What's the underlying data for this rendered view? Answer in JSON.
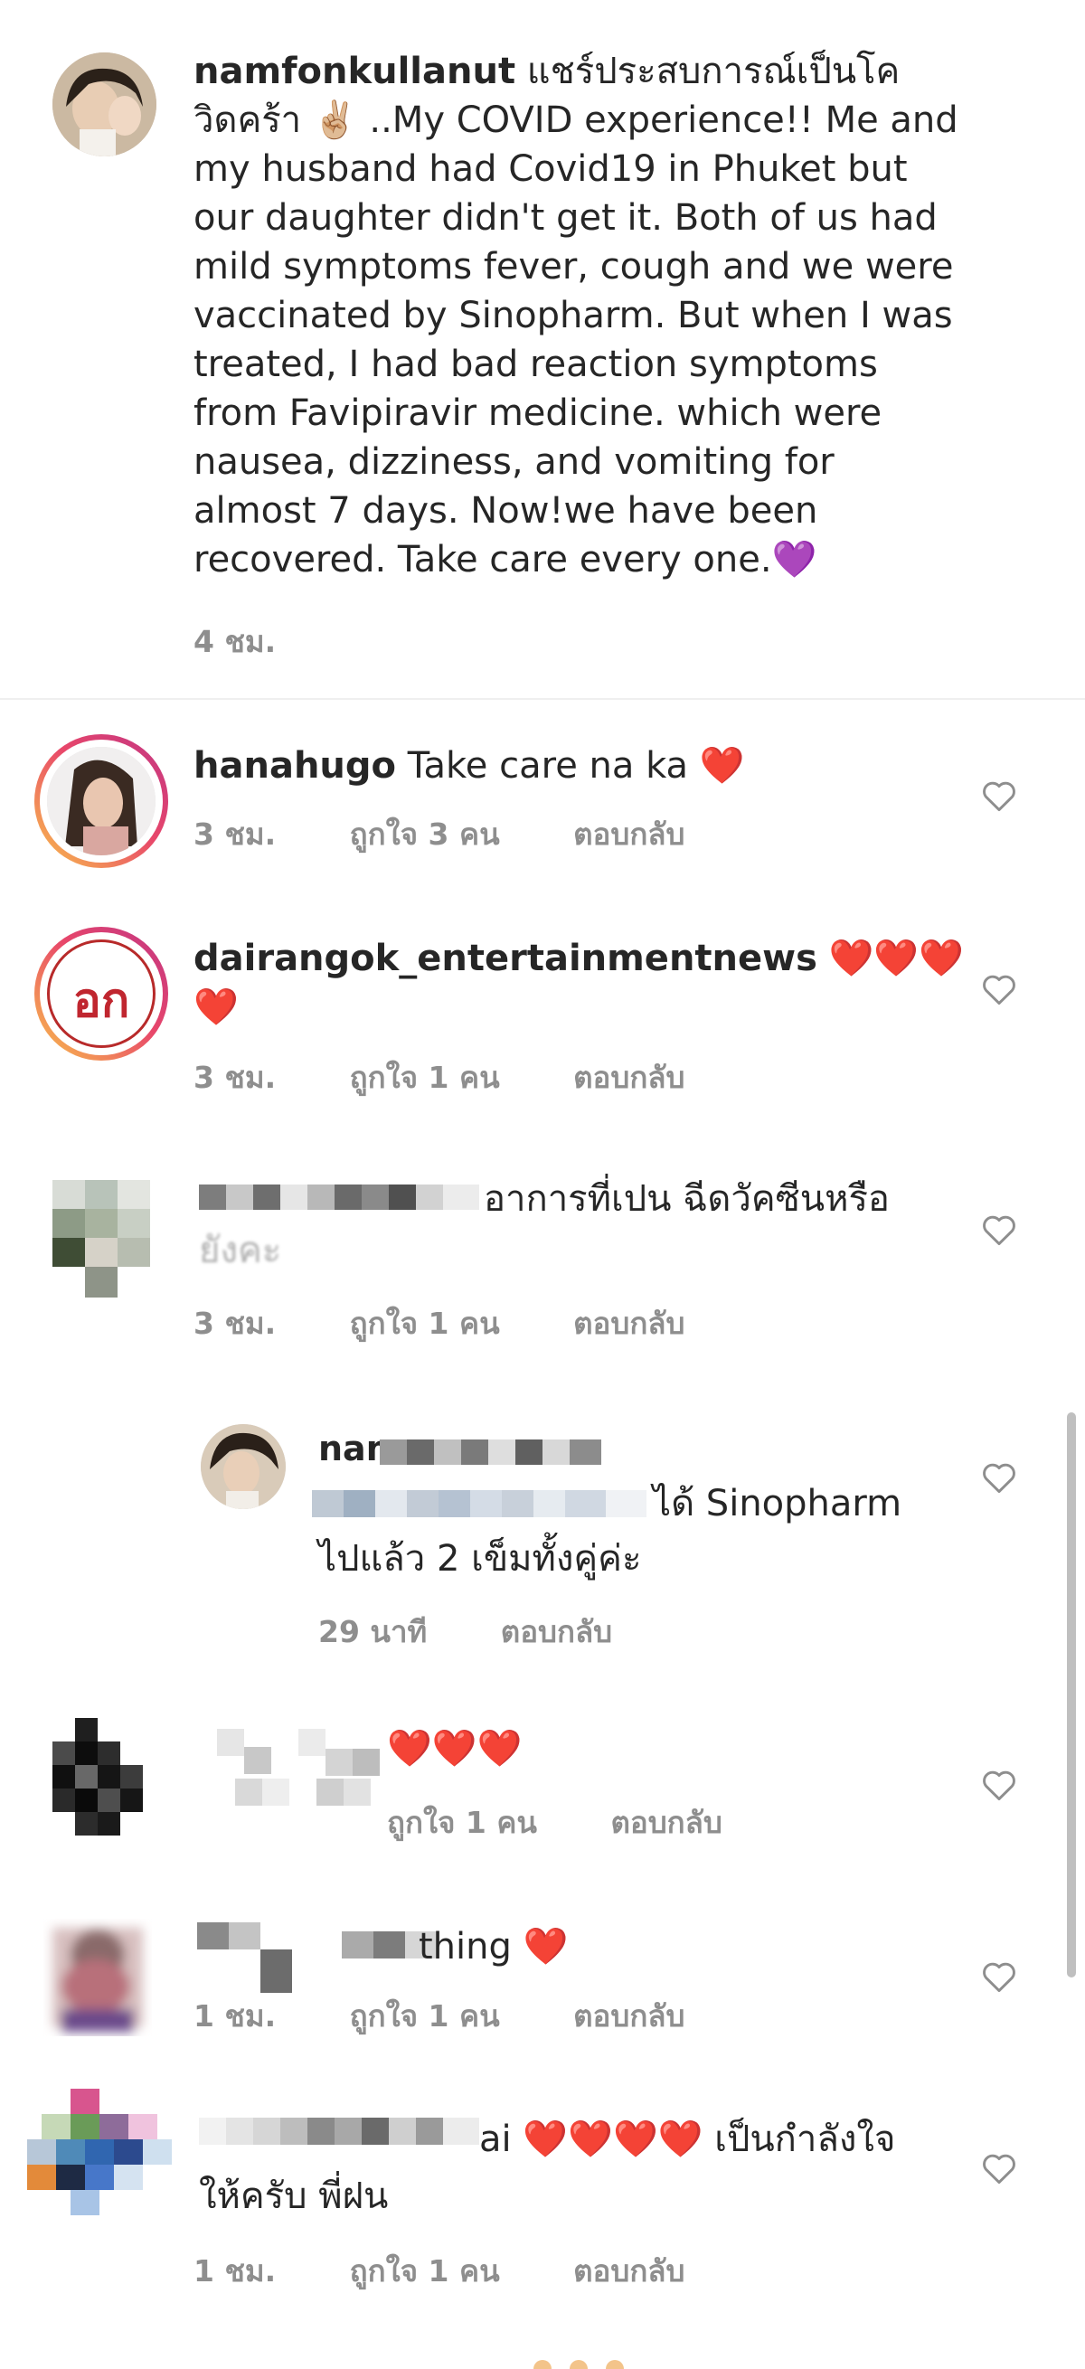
{
  "caption": {
    "username": "namfonkullanut",
    "lines": [
      "แชร์ประสบการณ์เป็นโค",
      "วิดคร้า ✌🏼 ..My COVID experience!! Me and",
      "my husband had Covid19 in Phuket but",
      "our daughter didn't get it. Both of us had",
      "mild symptoms fever, cough and we were",
      "vaccinated by Sinopharm. But when I was",
      "treated, I had bad reaction symptoms",
      "from Favipiravir medicine. which were",
      "nausea, dizziness, and vomiting for",
      "almost 7 days. Now!we have been",
      "recovered. Take care every one.💜"
    ],
    "time": "4 ชม."
  },
  "comments": [
    {
      "username": "hanahugo",
      "text": "Take care na ka ❤️",
      "time": "3 ชม.",
      "likes": "ถูกใจ 3 คน",
      "reply": "ตอบกลับ"
    },
    {
      "username": "dairangok_entertainmentnews",
      "text": "❤️❤️❤️",
      "text2": "❤️",
      "time": "3 ชม.",
      "likes": "ถูกใจ 1 คน",
      "reply": "ตอบกลับ",
      "avatar_text": "อก"
    },
    {
      "text": "อาการที่เปน ฉีดวัคซีนหรือ",
      "text2": "ยังคะ",
      "time": "3 ชม.",
      "likes": "ถูกใจ 1 คน",
      "reply": "ตอบกลับ"
    },
    {
      "username_partial": "nam",
      "text": "ได้ Sinopharm",
      "text2": "ไปแล้ว 2 เข็มทั้งคู่ค่ะ",
      "time": "29 นาที",
      "reply": "ตอบกลับ"
    },
    {
      "text": "❤️❤️❤️",
      "likes": "ถูกใจ 1 คน",
      "reply": "ตอบกลับ"
    },
    {
      "text": "thing ❤️",
      "time": "1 ชม.",
      "likes": "ถูกใจ 1 คน",
      "reply": "ตอบกลับ"
    },
    {
      "text_partial": "ai",
      "text": "❤️❤️❤️❤️ เป็นกำลังใจ",
      "text2": "ให้ครับ พี่ฝน",
      "time": "1 ชม.",
      "likes": "ถูกใจ 1 คน",
      "reply": "ตอบกลับ"
    }
  ],
  "icons": {
    "like": "heart-outline-icon"
  },
  "colors": {
    "meta": "#8e8e8e",
    "text": "#262626",
    "heart": "#e0245e"
  }
}
